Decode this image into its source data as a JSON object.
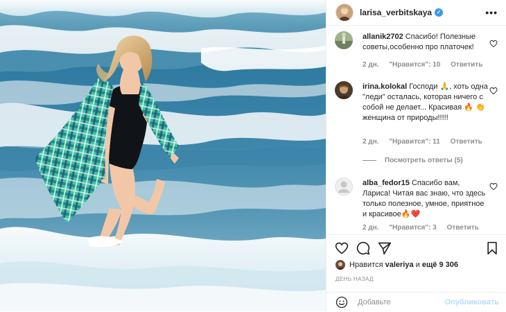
{
  "post": {
    "author": "larisa_verbitskaya",
    "verified_icon": "verified-badge-icon",
    "more_icon": "ellipsis-icon"
  },
  "comments": [
    {
      "user": "allanik2702",
      "text": "Спасибо! Полезные советы,особенно про платочек!",
      "time": "2 дн.",
      "likes": "\"Нравится\": 10",
      "reply": "Ответить"
    },
    {
      "user": "irina.kolokal",
      "text": "Господи 🙏, хоть одна \"леди\" осталась, которая ничего с собой не делает... Красивая 🔥 👏женщина от природы!!!!!",
      "time": "2 дн.",
      "likes": "\"Нравится\": 11",
      "reply": "Ответить",
      "view_replies": "Посмотреть ответы (5)"
    },
    {
      "user": "alba_fedor15",
      "text": "Спасибо вам, Лариса! Читая вас знаю, что здесь только полезное, умное, приятное и красивое🔥❤️",
      "time": "2 дн.",
      "likes": "\"Нравится\": 3",
      "reply": "Ответить"
    }
  ],
  "likes": {
    "prefix": "Нравится",
    "user": "valeriya",
    "and": "и",
    "count": "ещё 9 306"
  },
  "date": "ДЕНЬ НАЗАД",
  "add_comment": {
    "placeholder": "Добавьте",
    "publish": "Опубликовать"
  },
  "colors": {
    "link_blue": "#3897f0",
    "publish_disabled": "#b2dffc",
    "muted_text": "#8e8e8e"
  }
}
